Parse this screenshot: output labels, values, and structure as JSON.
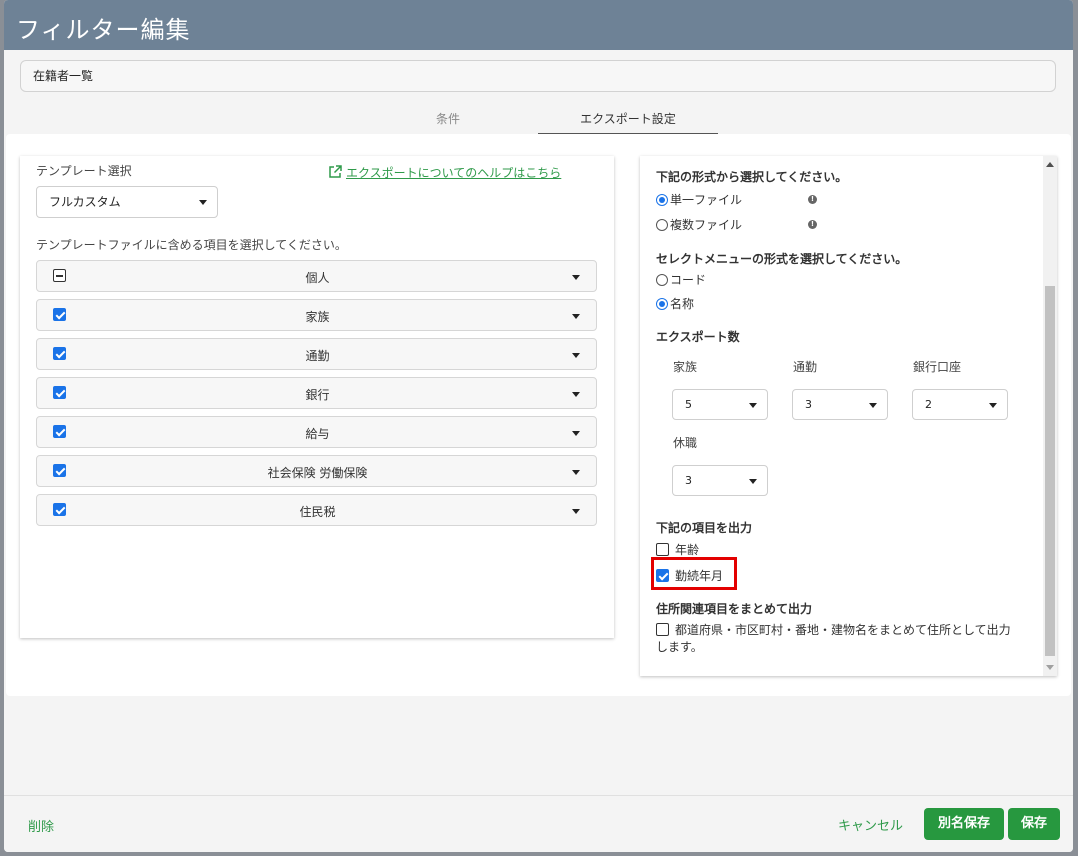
{
  "header": {
    "title": "フィルター編集"
  },
  "filter_name": {
    "value": "在籍者一覧"
  },
  "tabs": [
    {
      "label": "条件"
    },
    {
      "label": "エクスポート設定"
    }
  ],
  "left_panel": {
    "template_label": "テンプレート選択",
    "template_value": "フルカスタム",
    "help_link": "エクスポートについてのヘルプはこちら",
    "items_instruction": "テンプレートファイルに含める項目を選択してください。",
    "items": [
      {
        "label": "個人",
        "state": "indeterminate"
      },
      {
        "label": "家族",
        "state": "checked"
      },
      {
        "label": "通勤",
        "state": "checked"
      },
      {
        "label": "銀行",
        "state": "checked"
      },
      {
        "label": "給与",
        "state": "checked"
      },
      {
        "label": "社会保険 労働保険",
        "state": "checked"
      },
      {
        "label": "住民税",
        "state": "checked"
      }
    ]
  },
  "right_panel": {
    "format_heading": "下記の形式から選択してください。",
    "format_options": [
      {
        "label": "単一ファイル",
        "selected": true
      },
      {
        "label": "複数ファイル",
        "selected": false
      }
    ],
    "menu_heading": "セレクトメニューの形式を選択してください。",
    "menu_options": [
      {
        "label": "コード",
        "selected": false
      },
      {
        "label": "名称",
        "selected": true
      }
    ],
    "export_count_heading": "エクスポート数",
    "counts": [
      {
        "label": "家族",
        "value": "5"
      },
      {
        "label": "通勤",
        "value": "3"
      },
      {
        "label": "銀行口座",
        "value": "2"
      },
      {
        "label": "休職",
        "value": "3"
      }
    ],
    "output_heading": "下記の項目を出力",
    "output_items": [
      {
        "label": "年齢",
        "checked": false
      },
      {
        "label": "勤続年月",
        "checked": true
      }
    ],
    "address_heading": "住所関連項目をまとめて出力",
    "address_option": {
      "label_line1": "都道府県・市区町村・番地・建物名をまとめて住所として出力",
      "label_line2": "します。",
      "checked": false
    }
  },
  "footer": {
    "delete_label": "削除",
    "cancel_label": "キャンセル",
    "save_as_label": "別名保存",
    "save_label": "保存"
  },
  "colors": {
    "header_bg": "#6e8296",
    "accent_green": "#27983f",
    "checkbox_blue": "#1a73e8",
    "highlight_red": "#e30000"
  }
}
